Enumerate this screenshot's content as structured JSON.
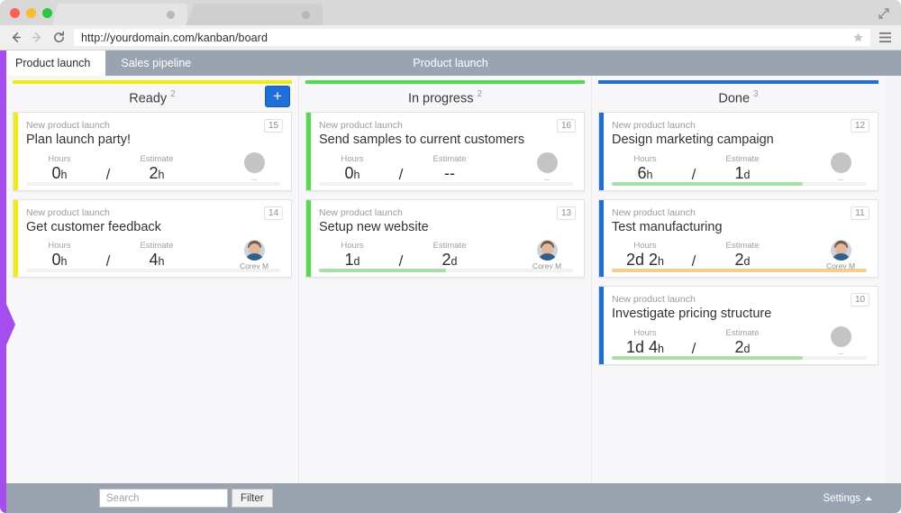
{
  "browser": {
    "url": "http://yourdomain.com/kanban/board",
    "back_icon": "back-arrow-icon",
    "forward_icon": "forward-arrow-icon",
    "reload_icon": "reload-icon",
    "star_icon": "star-icon",
    "menu_icon": "hamburger-menu-icon",
    "maximize_icon": "maximize-icon"
  },
  "tabs": [
    {
      "label": "Product launch",
      "active": true
    },
    {
      "label": "Sales pipeline",
      "active": false
    }
  ],
  "board_title": "Product launch",
  "colors": {
    "ready": "#f0ec0b",
    "in_progress": "#4ede4b",
    "done": "#1e6fd9",
    "progress_green": "#a8dfa6",
    "progress_orange": "#f5cd8e",
    "accent_blue": "#1e6fd9",
    "rail_purple": "#a64df0"
  },
  "columns": [
    {
      "name": "Ready",
      "count": "2",
      "accent": "#f0ec0b",
      "has_add_button": true,
      "add_label": "+",
      "cards": [
        {
          "project": "New product launch",
          "title": "Plan launch party!",
          "id": "15",
          "hours_label": "Hours",
          "hours_value": "0",
          "hours_unit": "h",
          "estimate_label": "Estimate",
          "estimate_value": "2",
          "estimate_unit": "h",
          "separator": "/",
          "assignee": "",
          "assignee_placeholder": "--",
          "has_avatar_photo": false,
          "progress_percent": 0,
          "progress_color": "#a8dfa6"
        },
        {
          "project": "New product launch",
          "title": "Get customer feedback",
          "id": "14",
          "hours_label": "Hours",
          "hours_value": "0",
          "hours_unit": "h",
          "estimate_label": "Estimate",
          "estimate_value": "4",
          "estimate_unit": "h",
          "separator": "/",
          "assignee": "Corey M",
          "assignee_placeholder": "",
          "has_avatar_photo": true,
          "progress_percent": 0,
          "progress_color": "#a8dfa6"
        }
      ]
    },
    {
      "name": "In progress",
      "count": "2",
      "accent": "#4ede4b",
      "has_add_button": false,
      "add_label": "",
      "cards": [
        {
          "project": "New product launch",
          "title": "Send samples to current customers",
          "id": "16",
          "hours_label": "Hours",
          "hours_value": "0",
          "hours_unit": "h",
          "estimate_label": "Estimate",
          "estimate_value": "--",
          "estimate_unit": "",
          "separator": "/",
          "assignee": "",
          "assignee_placeholder": "--",
          "has_avatar_photo": false,
          "progress_percent": 0,
          "progress_color": "#a8dfa6"
        },
        {
          "project": "New product launch",
          "title": "Setup new website",
          "id": "13",
          "hours_label": "Hours",
          "hours_value": "1",
          "hours_unit": "d",
          "estimate_label": "Estimate",
          "estimate_value": "2",
          "estimate_unit": "d",
          "separator": "/",
          "assignee": "Corey M",
          "assignee_placeholder": "",
          "has_avatar_photo": true,
          "progress_percent": 50,
          "progress_color": "#a8dfa6"
        }
      ]
    },
    {
      "name": "Done",
      "count": "3",
      "accent": "#1e6fd9",
      "has_add_button": false,
      "add_label": "",
      "cards": [
        {
          "project": "New product launch",
          "title": "Design marketing campaign",
          "id": "12",
          "hours_label": "Hours",
          "hours_value": "6",
          "hours_unit": "h",
          "estimate_label": "Estimate",
          "estimate_value": "1",
          "estimate_unit": "d",
          "separator": "/",
          "assignee": "",
          "assignee_placeholder": "--",
          "has_avatar_photo": false,
          "progress_percent": 75,
          "progress_color": "#a8dfa6"
        },
        {
          "project": "New product launch",
          "title": "Test manufacturing",
          "id": "11",
          "hours_label": "Hours",
          "hours_value": "2d 2",
          "hours_unit": "h",
          "estimate_label": "Estimate",
          "estimate_value": "2",
          "estimate_unit": "d",
          "separator": "/",
          "assignee": "Corey M",
          "assignee_placeholder": "",
          "has_avatar_photo": true,
          "progress_percent": 100,
          "progress_color": "#f5cd8e"
        },
        {
          "project": "New product launch",
          "title": "Investigate pricing structure",
          "id": "10",
          "hours_label": "Hours",
          "hours_value": "1d 4",
          "hours_unit": "h",
          "estimate_label": "Estimate",
          "estimate_value": "2",
          "estimate_unit": "d",
          "separator": "/",
          "assignee": "",
          "assignee_placeholder": "--",
          "has_avatar_photo": false,
          "progress_percent": 75,
          "progress_color": "#a8dfa6"
        }
      ]
    }
  ],
  "bottom": {
    "search_placeholder": "Search",
    "search_value": "",
    "filter_label": "Filter",
    "settings_label": "Settings",
    "settings_caret": "caret-up-icon"
  }
}
